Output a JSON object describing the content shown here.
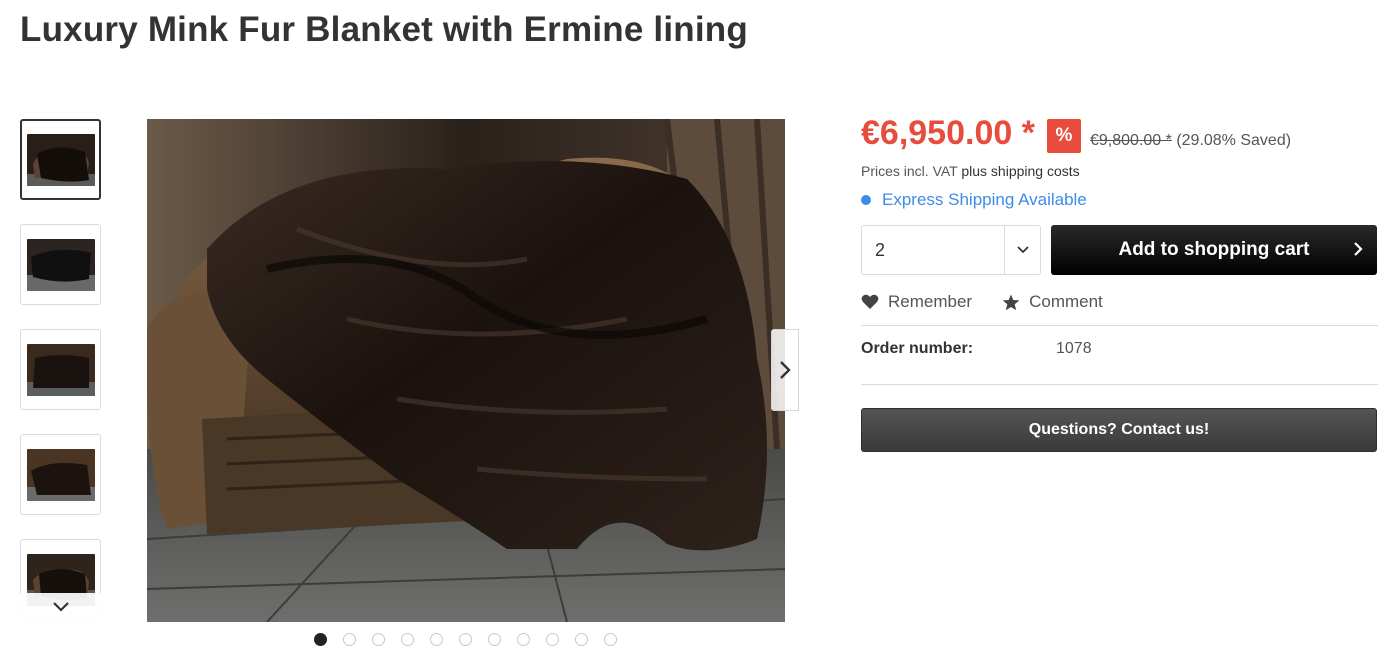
{
  "product": {
    "title": "Luxury Mink Fur Blanket with Ermine lining"
  },
  "gallery": {
    "thumbnails": [
      "thumb-1",
      "thumb-2",
      "thumb-3",
      "thumb-4",
      "thumb-5"
    ],
    "active_thumbnail": 1,
    "thumb_scroll_icon": "chevron-down-icon",
    "next_icon": "chevron-right-icon",
    "dots_count": 11,
    "active_dot": 1
  },
  "buybox": {
    "price": "€6,950.00 *",
    "discount_badge": "%",
    "old_price": "€9,800.00 *",
    "saved_text": "(29.08% Saved)",
    "vat_text": "Prices incl. VAT",
    "shipping_text": "plus shipping costs",
    "express_text": "Express Shipping Available",
    "quantity": "2",
    "add_to_cart_label": "Add to shopping cart",
    "remember_label": "Remember",
    "comment_label": "Comment",
    "order_number_label": "Order number:",
    "order_number_value": "1078",
    "contact_label": "Questions? Contact us!"
  },
  "colors": {
    "price_red": "#e74c3c",
    "express_blue": "#3c8ce7",
    "cart_button": "#000000",
    "contact_button": "#444444"
  }
}
